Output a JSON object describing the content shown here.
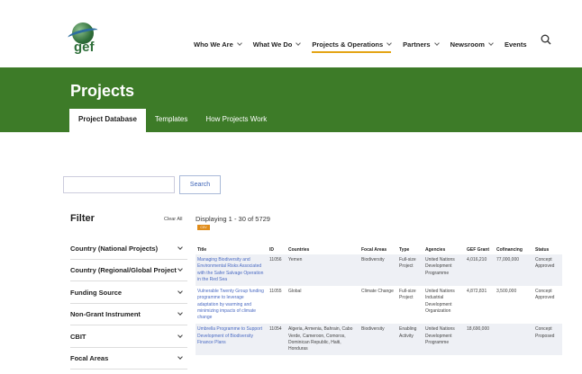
{
  "header": {
    "logo_text": "gef",
    "nav": [
      {
        "label": "Who We Are"
      },
      {
        "label": "What We Do"
      },
      {
        "label": "Projects & Operations"
      },
      {
        "label": "Partners"
      },
      {
        "label": "Newsroom"
      },
      {
        "label": "Events"
      }
    ],
    "accent": "#e4a414"
  },
  "band": {
    "title": "Projects",
    "color": "#3d7b28",
    "tabs": [
      {
        "label": "Project Database"
      },
      {
        "label": "Templates"
      },
      {
        "label": "How Projects Work"
      }
    ]
  },
  "search": {
    "placeholder": "",
    "button_label": "Search"
  },
  "filter": {
    "title": "Filter",
    "clear_label": "Clear All",
    "items": [
      {
        "label": "Country (National Projects)"
      },
      {
        "label": "Country (Regional/Global Projects)"
      },
      {
        "label": "Funding Source"
      },
      {
        "label": "Non-Grant Instrument"
      },
      {
        "label": "CBIT"
      },
      {
        "label": "Focal Areas"
      }
    ]
  },
  "results": {
    "displaying": "Displaying 1 - 30 of 5729",
    "csv_label": "CSV",
    "columns": [
      "Title",
      "ID",
      "Countries",
      "Focal Areas",
      "Type",
      "Agencies",
      "GEF Grant",
      "Cofinancing",
      "Status"
    ],
    "rows": [
      {
        "title": "Managing Biodiversity and Environmental Risks Associated with the Safer Salvage Operation in the Red Sea",
        "id": "11056",
        "countries": "Yemen",
        "focal": "Biodiversity",
        "type": "Full-size Project",
        "agency": "United Nations Development Programme",
        "grant": "4,016,210",
        "cofinancing": "77,000,000",
        "status": "Concept Approved"
      },
      {
        "title": "Vulnerable Twenty Group funding programme to leverage adaptation by warming and minimizing impacts of climate change",
        "id": "11055",
        "countries": "Global",
        "focal": "Climate Change",
        "type": "Full-size Project",
        "agency": "United Nations Industrial Development Organization",
        "grant": "4,872,831",
        "cofinancing": "3,500,000",
        "status": "Concept Approved"
      },
      {
        "title": "Umbrella Programme to Support Development of Biodiversity Finance Plans",
        "id": "11054",
        "countries": "Algeria, Armenia, Bahrain, Cabo Verde, Cameroon, Comoros, Dominican Republic, Haiti, Honduras",
        "focal": "Biodiversity",
        "type": "Enabling Activity",
        "agency": "United Nations Development Programme",
        "grant": "18,690,000",
        "cofinancing": "",
        "status": "Concept Proposed"
      }
    ]
  }
}
